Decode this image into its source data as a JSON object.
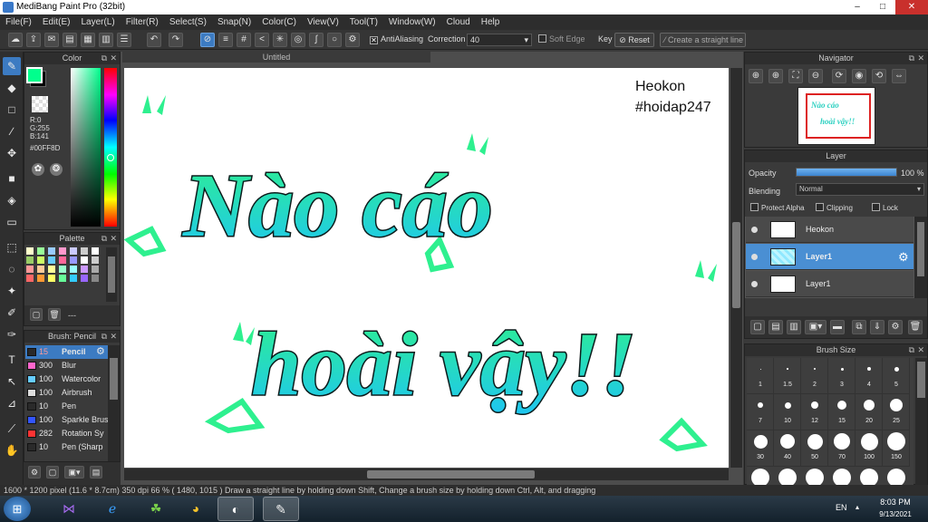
{
  "window": {
    "title": "MediBang Paint Pro (32bit)",
    "min": "–",
    "max": "□",
    "close": "✕"
  },
  "menu": [
    "File(F)",
    "Edit(E)",
    "Layer(L)",
    "Filter(R)",
    "Select(S)",
    "Snap(N)",
    "Color(C)",
    "View(V)",
    "Tool(T)",
    "Window(W)",
    "Cloud",
    "Help"
  ],
  "options": {
    "antialiasing_label": "AntiAliasing",
    "correction_label": "Correction",
    "correction_value": "40",
    "soft_edge_label": "Soft Edge",
    "key_label": "Key",
    "reset_label": "Reset",
    "straight_line_label": "Create a straight line"
  },
  "color_panel": {
    "title": "Color",
    "r": "R:0",
    "g": "G:255",
    "b": "B:141",
    "hex": "#00FF8D",
    "foreground": "#00ff8d",
    "background": "#000000"
  },
  "palette_panel": {
    "title": "Palette",
    "label": "---",
    "swatches": [
      "#ffffcc",
      "#99ff99",
      "#99ccff",
      "#ff99cc",
      "#ccccff",
      "#cccccc",
      "#ffffff",
      "#99cc66",
      "#ccff66",
      "#66ccff",
      "#ff6699",
      "#9999ff",
      "#ffffff",
      "#cccccc",
      "#ff9999",
      "#ffcc99",
      "#ffff99",
      "#99ffcc",
      "#99ffff",
      "#cc99ff",
      "#aaaaaa",
      "#ff6666",
      "#ff9933",
      "#ffff66",
      "#66ff99",
      "#33ccff",
      "#9966ff",
      "#888888"
    ]
  },
  "brush_panel": {
    "title": "Brush: Pencil",
    "items": [
      {
        "size": "15",
        "name": "Pencil",
        "color": "#2a2a2a"
      },
      {
        "size": "300",
        "name": "Blur",
        "color": "#ff66cc"
      },
      {
        "size": "100",
        "name": "Watercolor",
        "color": "#66ccff"
      },
      {
        "size": "100",
        "name": "Airbrush",
        "color": "#dddddd"
      },
      {
        "size": "10",
        "name": "Pen",
        "color": "#2a2a2a"
      },
      {
        "size": "100",
        "name": "Sparkle Brus",
        "color": "#3355ff"
      },
      {
        "size": "282",
        "name": "Rotation Sy",
        "color": "#ff3333"
      },
      {
        "size": "10",
        "name": "Pen (Sharp",
        "color": "#2a2a2a"
      }
    ]
  },
  "canvas": {
    "tab_title": "Untitled",
    "author": "Heokon",
    "hashtag": "#hoidap247",
    "line1": "Nào cáo",
    "line2": "hoài vậy!!"
  },
  "navigator": {
    "title": "Navigator"
  },
  "layer_panel": {
    "title": "Layer",
    "opacity_label": "Opacity",
    "opacity_value": "100 %",
    "opacity": 1.0,
    "blending_label": "Blending",
    "blending_value": "Normal",
    "protect_alpha_label": "Protect Alpha",
    "clipping_label": "Clipping",
    "lock_label": "Lock",
    "layers": [
      {
        "name": "Heokon",
        "selected": false
      },
      {
        "name": "Layer1",
        "selected": true
      },
      {
        "name": "Layer1",
        "selected": false
      }
    ]
  },
  "brush_size_panel": {
    "title": "Brush Size",
    "sizes": [
      "1",
      "1.5",
      "2",
      "3",
      "4",
      "5",
      "7",
      "10",
      "12",
      "15",
      "20",
      "25",
      "30",
      "40",
      "50",
      "70",
      "100",
      "150"
    ]
  },
  "status": "1600 * 1200 pixel  (11.6 * 8.7cm)  350 dpi  66 %  ( 1480, 1015 )  Draw a straight line by holding down Shift, Change a brush size by holding down Ctrl, Alt, and dragging",
  "taskbar": {
    "lang": "EN",
    "time": "8:03 PM",
    "date": "9/13/2021"
  }
}
